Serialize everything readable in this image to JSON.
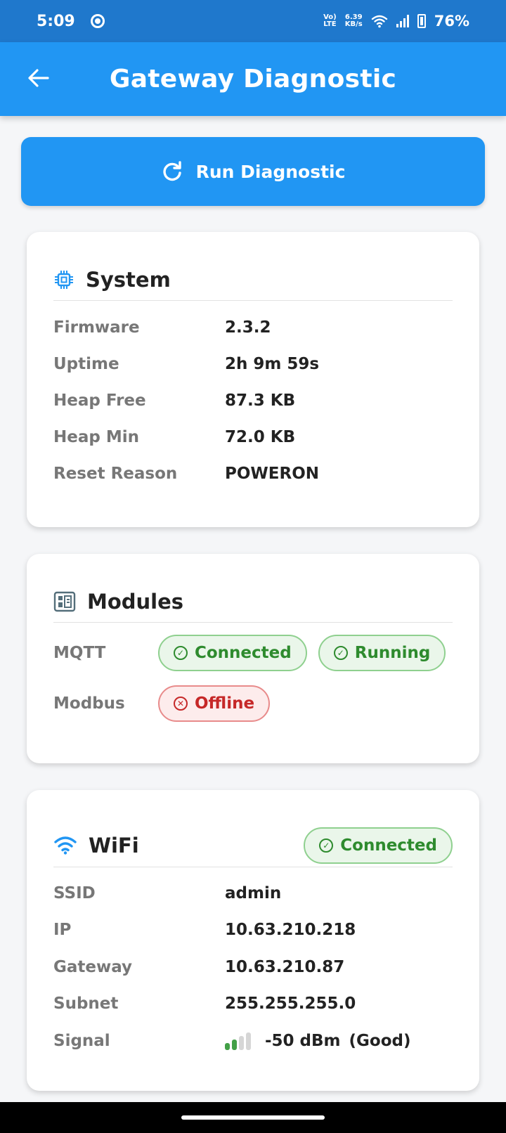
{
  "status_bar": {
    "time": "5:09",
    "volte_top": "Vo)",
    "volte_bottom": "LTE",
    "speed_value": "6.39",
    "speed_unit": "KB/s",
    "battery": "76%"
  },
  "app_bar": {
    "title": "Gateway Diagnostic"
  },
  "run_button": {
    "label": "Run Diagnostic"
  },
  "system": {
    "title": "System",
    "rows": [
      {
        "label": "Firmware",
        "value": "2.3.2"
      },
      {
        "label": "Uptime",
        "value": "2h 9m 59s"
      },
      {
        "label": "Heap Free",
        "value": "87.3 KB"
      },
      {
        "label": "Heap Min",
        "value": "72.0 KB"
      },
      {
        "label": "Reset Reason",
        "value": "POWERON"
      }
    ]
  },
  "modules": {
    "title": "Modules",
    "mqtt": {
      "label": "MQTT",
      "chips": [
        "Connected",
        "Running"
      ]
    },
    "modbus": {
      "label": "Modbus",
      "chip": "Offline"
    }
  },
  "wifi": {
    "title": "WiFi",
    "status": "Connected",
    "rows": [
      {
        "label": "SSID",
        "value": "admin"
      },
      {
        "label": "IP",
        "value": "10.63.210.218"
      },
      {
        "label": "Gateway",
        "value": "10.63.210.87"
      },
      {
        "label": "Subnet",
        "value": "255.255.255.0"
      }
    ],
    "signal": {
      "label": "Signal",
      "value": "-50 dBm",
      "quality": "(Good)",
      "bars_filled": 2,
      "bars_total": 4
    }
  },
  "colors": {
    "primary": "#2196f3",
    "status_bar": "#1f78cc",
    "ok": "#2e8b2e",
    "error": "#c62828"
  }
}
